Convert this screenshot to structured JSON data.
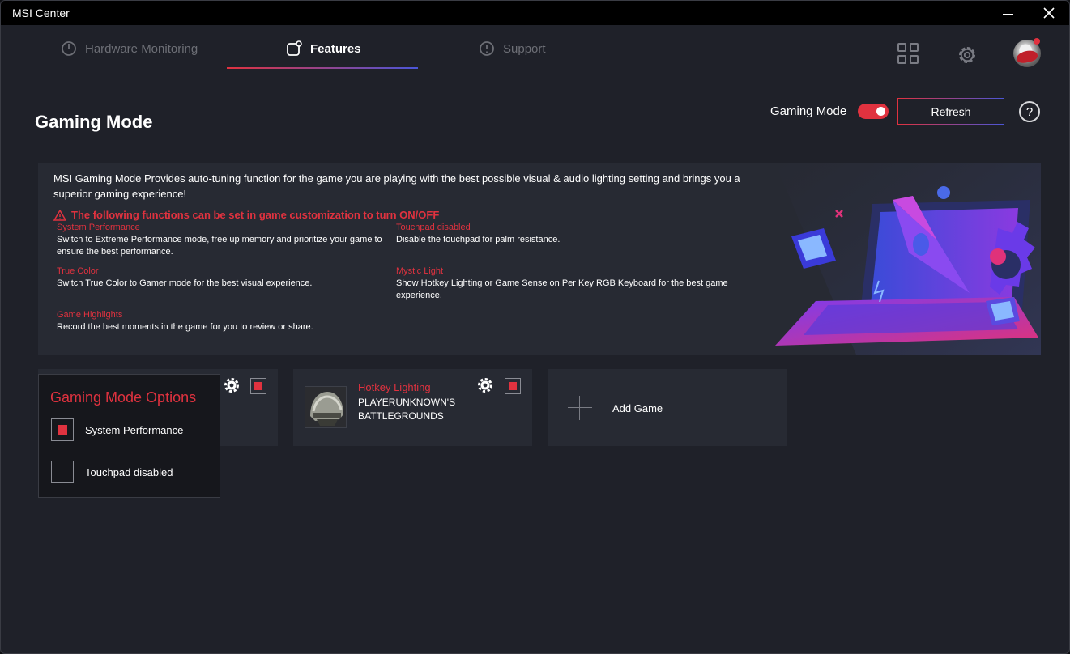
{
  "window": {
    "title": "MSI Center"
  },
  "nav": {
    "tabs": [
      {
        "label": "Hardware Monitoring",
        "active": false,
        "icon": "gauge-icon"
      },
      {
        "label": "Features",
        "active": true,
        "icon": "features-icon"
      },
      {
        "label": "Support",
        "active": false,
        "icon": "support-icon"
      }
    ],
    "right_icons": [
      "grid-icon",
      "gear-icon",
      "avatar"
    ]
  },
  "page": {
    "title": "Gaming Mode",
    "toggle_label": "Gaming Mode",
    "toggle_on": true,
    "refresh_label": "Refresh",
    "help_label": "?"
  },
  "info": {
    "description": "MSI Gaming Mode Provides auto-tuning function for the game you are playing with the best possible visual & audio lighting setting and brings you a superior gaming experience!",
    "warning": "The following functions can be set in game customization to turn ON/OFF",
    "features": [
      {
        "name": "System Performance",
        "desc": "Switch to Extreme Performance mode, free up memory and prioritize your game to ensure the best performance."
      },
      {
        "name": "Touchpad disabled",
        "desc": "Disable the touchpad for palm resistance."
      },
      {
        "name": "True Color",
        "desc": "Switch True Color to Gamer mode for the best visual experience."
      },
      {
        "name": "Mystic Light",
        "desc": "Show Hotkey Lighting or Game Sense on Per Key RGB Keyboard for the best game experience."
      },
      {
        "name": "Game Highlights",
        "desc": "Record the best moments in the game for you to review or share."
      }
    ]
  },
  "cards": [
    {
      "category": "",
      "game": "",
      "checked": true
    },
    {
      "category": "Hotkey Lighting",
      "game": "PLAYERUNKNOWN'S BATTLEGROUNDS",
      "checked": true
    }
  ],
  "add_game": {
    "label": "Add Game"
  },
  "popup": {
    "title": "Gaming Mode Options",
    "options": [
      {
        "label": "System Performance",
        "checked": true
      },
      {
        "label": "Touchpad disabled",
        "checked": false
      }
    ]
  },
  "colors": {
    "accent_red": "#e0323f",
    "accent_blue": "#4a56d8",
    "background": "#1f2129",
    "panel": "#272a33"
  }
}
